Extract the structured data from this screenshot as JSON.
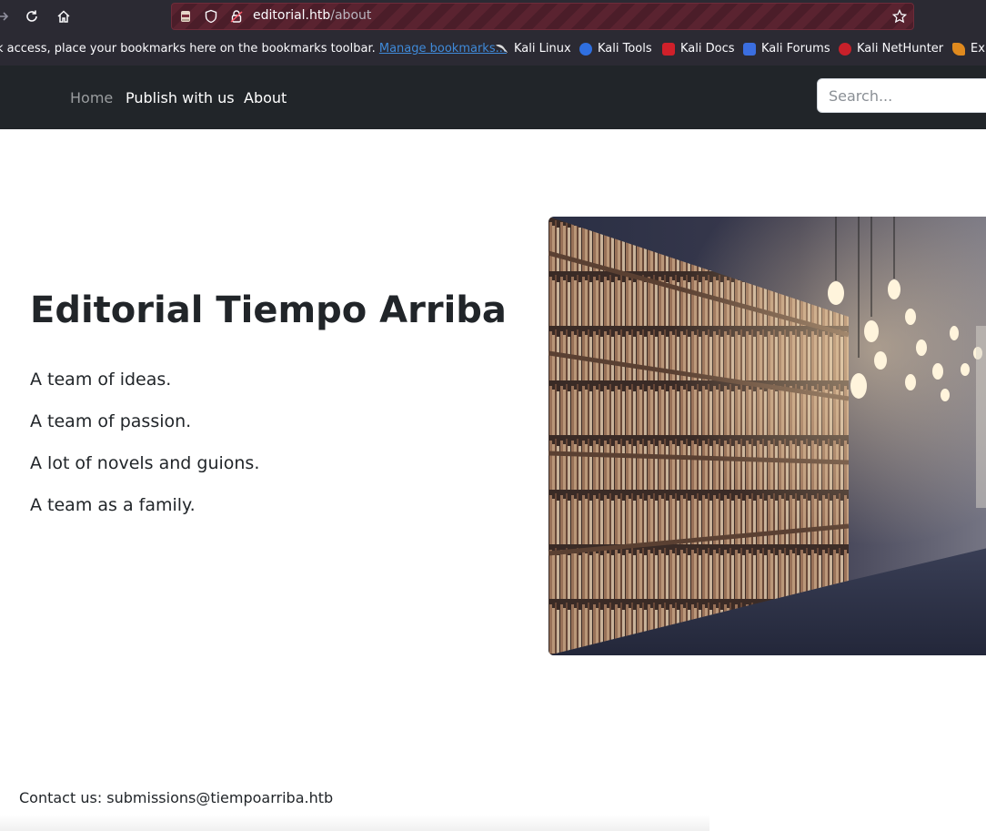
{
  "browser": {
    "url_host": "editorial.htb",
    "url_path": "/about",
    "bookmarks_message": "k access, place your bookmarks here on the bookmarks toolbar.",
    "manage_bookmarks": "Manage bookmarks...",
    "bookmarks": [
      {
        "label": "Kali Linux",
        "icon": "kali-dragon-icon",
        "color": "#1a1a1a"
      },
      {
        "label": "Kali Tools",
        "icon": "kali-tools-icon",
        "color": "#2f6fe0"
      },
      {
        "label": "Kali Docs",
        "icon": "kali-docs-icon",
        "color": "#d0202a"
      },
      {
        "label": "Kali Forums",
        "icon": "kali-forums-icon",
        "color": "#3b6ee0"
      },
      {
        "label": "Kali NetHunter",
        "icon": "kali-nethunter-icon",
        "color": "#c8202a"
      },
      {
        "label": "Exp",
        "icon": "exploit-db-icon",
        "color": "#e08a1e"
      }
    ]
  },
  "nav": {
    "links": [
      {
        "label": "Home"
      },
      {
        "label": "Publish with us"
      },
      {
        "label": "About"
      }
    ],
    "search_placeholder": "Search..."
  },
  "main": {
    "title": "Editorial Tiempo Arriba",
    "taglines": [
      "A team of ideas.",
      "A team of passion.",
      "A lot of novels and guions.",
      "A team as a family."
    ]
  },
  "footer": {
    "contact": "Contact us: submissions@tiempoarriba.htb"
  },
  "colors": {
    "navbar_bg": "#212529",
    "browser_bg": "#2b2a33",
    "link_blue": "#3f8ad9"
  }
}
